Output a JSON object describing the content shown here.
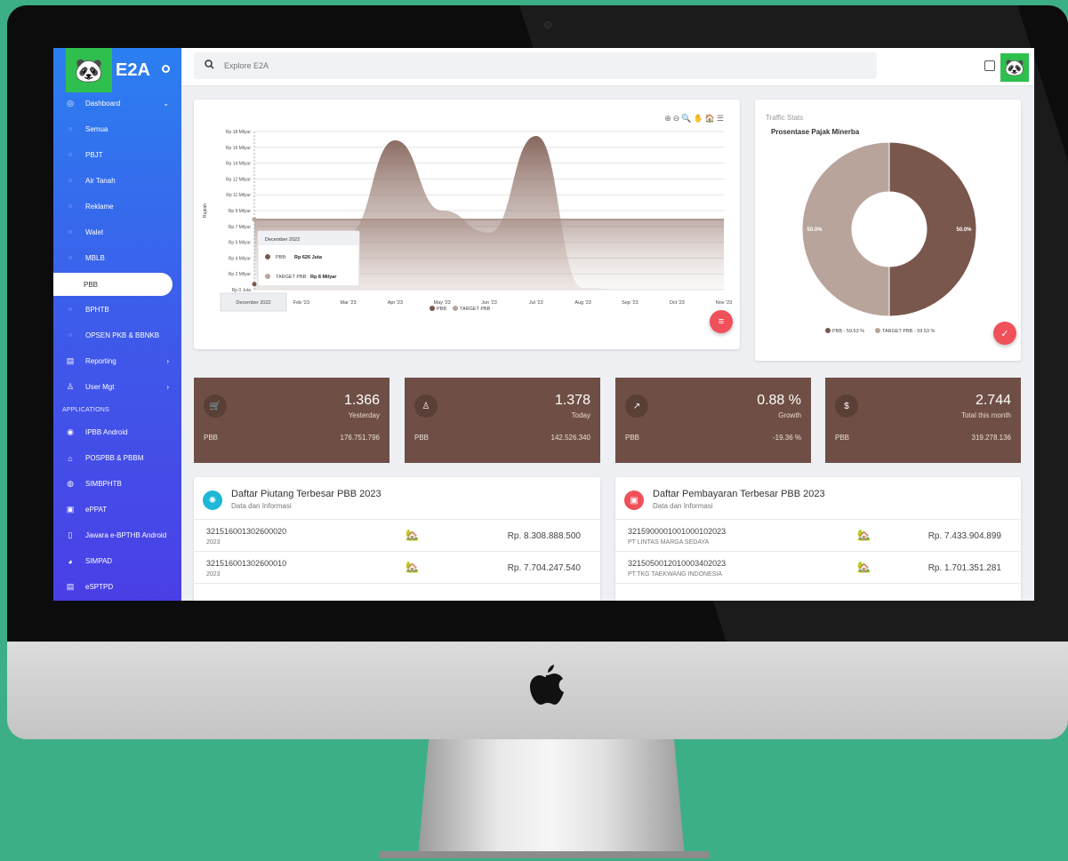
{
  "app": {
    "title": "E2A",
    "search_placeholder": "Explore E2A"
  },
  "sidebar": {
    "items": [
      {
        "label": "Dashboard",
        "icon": "dashboard-icon",
        "glyph": "◎",
        "chev": "⌄",
        "sub": false
      },
      {
        "label": "Semua",
        "icon": "circle-icon",
        "glyph": "○",
        "chev": "",
        "sub": true
      },
      {
        "label": "PBJT",
        "icon": "circle-icon",
        "glyph": "○",
        "chev": "",
        "sub": true
      },
      {
        "label": "Air Tanah",
        "icon": "circle-icon",
        "glyph": "○",
        "chev": "",
        "sub": true
      },
      {
        "label": "Reklame",
        "icon": "circle-icon",
        "glyph": "○",
        "chev": "",
        "sub": true
      },
      {
        "label": "Walet",
        "icon": "circle-icon",
        "glyph": "○",
        "chev": "",
        "sub": true
      },
      {
        "label": "MBLB",
        "icon": "circle-icon",
        "glyph": "○",
        "chev": "",
        "sub": true
      },
      {
        "label": "PBB",
        "icon": "circle-icon",
        "glyph": "",
        "chev": "",
        "sub": true,
        "active": true
      },
      {
        "label": "BPHTB",
        "icon": "circle-icon",
        "glyph": "○",
        "chev": "",
        "sub": true
      },
      {
        "label": "OPSEN PKB & BBNKB",
        "icon": "circle-icon",
        "glyph": "○",
        "chev": "",
        "sub": true
      },
      {
        "label": "Reporting",
        "icon": "report-icon",
        "glyph": "▤",
        "chev": "›",
        "sub": false
      },
      {
        "label": "User Mgt",
        "icon": "user-icon",
        "glyph": "♙",
        "chev": "›",
        "sub": false
      }
    ],
    "section_label": "APPLICATIONS",
    "apps": [
      {
        "label": "IPBB Android",
        "icon": "android-icon",
        "glyph": "◉"
      },
      {
        "label": "POSPBB & PBBM",
        "icon": "home-icon",
        "glyph": "⌂"
      },
      {
        "label": "SIMBPHTB",
        "icon": "globe-icon",
        "glyph": "◍"
      },
      {
        "label": "ePPAT",
        "icon": "badge-icon",
        "glyph": "▣"
      },
      {
        "label": "Jawara e-BPTHB Android",
        "icon": "phone-icon",
        "glyph": "▯"
      },
      {
        "label": "SIMPAD",
        "icon": "pie-icon",
        "glyph": "◕"
      },
      {
        "label": "eSPTPD",
        "icon": "doc-icon",
        "glyph": "▤"
      }
    ]
  },
  "chart_data": [
    {
      "type": "area",
      "ylabel": "Rupiah",
      "yticks": [
        "Rp 0 Juta",
        "Rp 2 Milyar",
        "Rp 4 Milyar",
        "Rp 5 Milyar",
        "Rp 7 Milyar",
        "Rp 9 Milyar",
        "Rp 11 Milyar",
        "Rp 12 Milyar",
        "Rp 14 Milyar",
        "Rp 16 Milyar",
        "Rp 18 Milyar"
      ],
      "categories": [
        "December 2022",
        "Feb '23",
        "Mar '23",
        "Apr '23",
        "May '23",
        "Jun '23",
        "Jul '23",
        "Aug '23",
        "Sep '23",
        "Oct '23",
        "Nov '23"
      ],
      "series": [
        {
          "name": "PBB",
          "color": "#7a574d",
          "values": [
            0.626,
            0.7,
            6.5,
            17.0,
            9.0,
            6.5,
            17.5,
            0.2,
            0,
            0,
            0
          ]
        },
        {
          "name": "TARGET PBB",
          "color": "#b9a49c",
          "values": [
            8,
            8,
            8,
            8,
            8,
            8,
            8,
            8,
            8,
            8,
            8
          ]
        }
      ],
      "ylim": [
        0,
        18
      ],
      "tooltip": {
        "title": "December 2022",
        "rows": [
          {
            "name": "PBB:",
            "value": "Rp 626 Juta",
            "color": "#7a574d"
          },
          {
            "name": "TARGET PBB:",
            "value": "Rp 8 Milyar",
            "color": "#b9a49c"
          }
        ]
      },
      "x_highlight": "December 2022",
      "legend": [
        "PBB",
        "TARGET PBB"
      ],
      "tools": "⊕⊖🔍✋🏠☰"
    },
    {
      "type": "pie",
      "title": "Prosentase Pajak Minerba",
      "slices": [
        {
          "name": "PBB",
          "value": 50.0,
          "label": "50.0%",
          "color": "#7a574d"
        },
        {
          "name": "TARGET PBB",
          "value": 50.0,
          "label": "50.0%",
          "color": "#b9a49c"
        }
      ],
      "legend": [
        "PBB - 59.53 %",
        "TARGET PBB - 59.53 %"
      ]
    }
  ],
  "traffic": {
    "title": "Traffic Stats",
    "subtitle": "Prosentase Pajak Minerba"
  },
  "kpis": [
    {
      "icon": "cart-icon",
      "glyph": "🛒",
      "value": "1.366",
      "label": "Yesterday",
      "name": "PBB",
      "amount": "176.751.796"
    },
    {
      "icon": "user-icon",
      "glyph": "♙",
      "value": "1.378",
      "label": "Today",
      "name": "PBB",
      "amount": "142.526.340"
    },
    {
      "icon": "trend-icon",
      "glyph": "↗",
      "value": "0.88 %",
      "label": "Growth",
      "name": "PBB",
      "amount": "-19.36 %"
    },
    {
      "icon": "dollar-icon",
      "glyph": "$",
      "value": "2.744",
      "label": "Total this month",
      "name": "PBB",
      "amount": "319.278.136"
    }
  ],
  "lists": [
    {
      "title": "Daftar Piutang Terbesar PBB 2023",
      "subtitle": "Data dan Informasi",
      "icon": "bug-icon",
      "glyph": "✺",
      "color": "#1fb7d6",
      "rows": [
        {
          "code": "321516001302600020",
          "sub": "2023",
          "amount": "Rp. 8.308.888.500"
        },
        {
          "code": "321516001302600010",
          "sub": "2023",
          "amount": "Rp. 7.704.247.540"
        }
      ]
    },
    {
      "title": "Daftar Pembayaran Terbesar PBB 2023",
      "subtitle": "Data dan Informasi",
      "icon": "bag-icon",
      "glyph": "▣",
      "color": "#f0505a",
      "rows": [
        {
          "code": "321590000100100010202 3",
          "sub": "PT LINTAS MARGA SEDAYA",
          "amount": "Rp. 7.433.904.899"
        },
        {
          "code": "321505001201000340202 3",
          "sub": "PT.TKG TAEKWANG INDONESIA",
          "amount": "Rp. 1.701.351.281"
        }
      ]
    }
  ]
}
